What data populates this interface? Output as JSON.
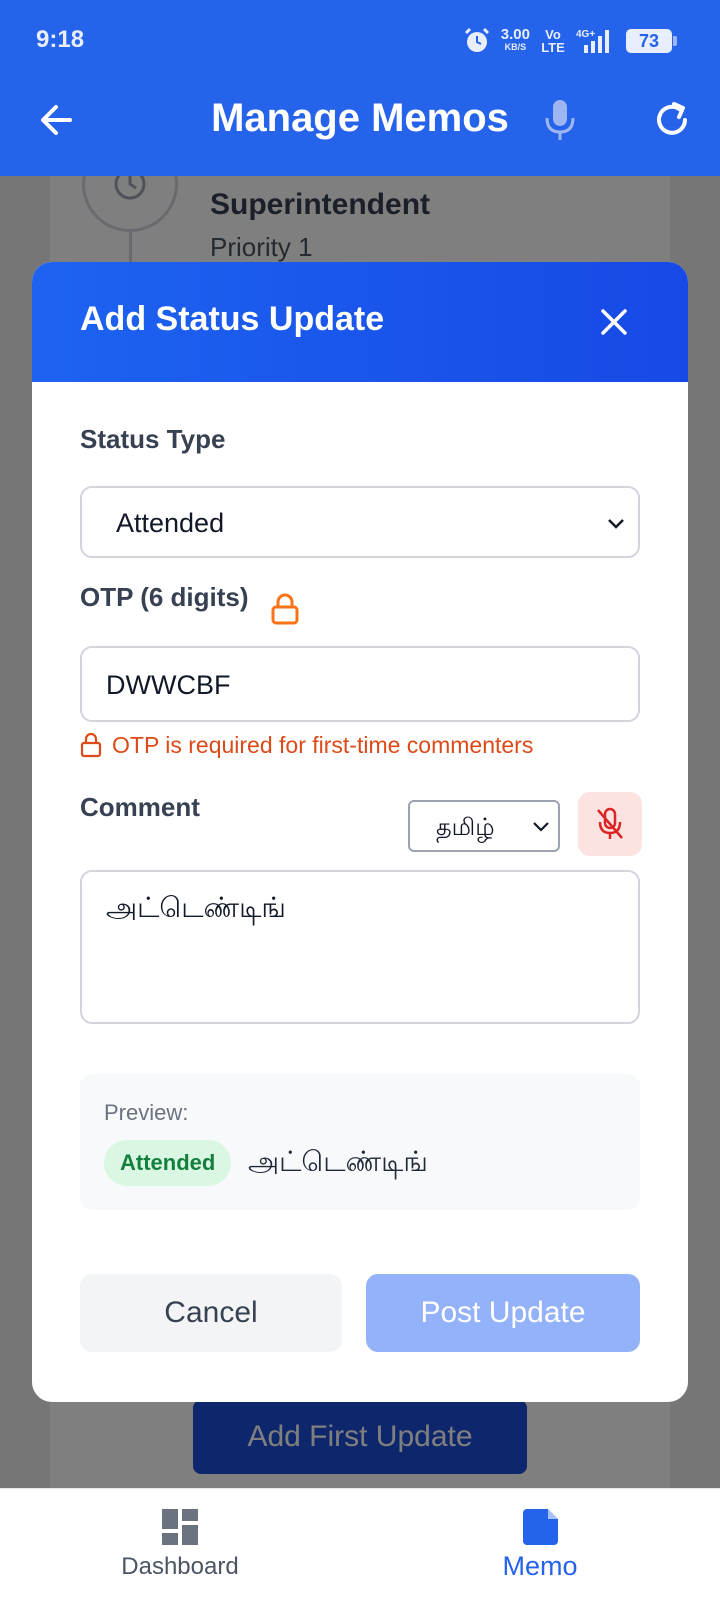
{
  "status_bar": {
    "time": "9:18",
    "net_speed": "3.00",
    "net_unit": "KB/S",
    "volte": "Vo LTE",
    "network": "4G+",
    "battery": "73"
  },
  "header": {
    "title": "Manage Memos",
    "back_icon": "arrow-left-icon",
    "mic_icon": "microphone-icon",
    "refresh_icon": "refresh-icon",
    "background_color": "#2563eb"
  },
  "background_card": {
    "role": "Superintendent",
    "priority": "Priority 1",
    "add_first_update_label": "Add First Update"
  },
  "modal": {
    "title": "Add Status Update",
    "status_type_label": "Status Type",
    "status_type_value": "Attended",
    "otp_label": "OTP (6 digits)",
    "otp_value": "DWWCBF",
    "otp_hint": "OTP is required for first-time commenters",
    "comment_label": "Comment",
    "language_value": "தமிழ்",
    "comment_value": "அட்டெண்டிங்",
    "preview_label": "Preview:",
    "preview_badge": "Attended",
    "preview_text": "அட்டெண்டிங்",
    "cancel_label": "Cancel",
    "post_label": "Post Update"
  },
  "bottom_nav": {
    "items": [
      {
        "label": "Dashboard",
        "icon": "dashboard-icon",
        "active": false
      },
      {
        "label": "Memo",
        "icon": "memo-icon",
        "active": true
      }
    ]
  },
  "colors": {
    "accent": "#2563eb",
    "warning": "#dc4a17",
    "success_badge": "#15803d",
    "disabled_button": "#93b2fa"
  }
}
